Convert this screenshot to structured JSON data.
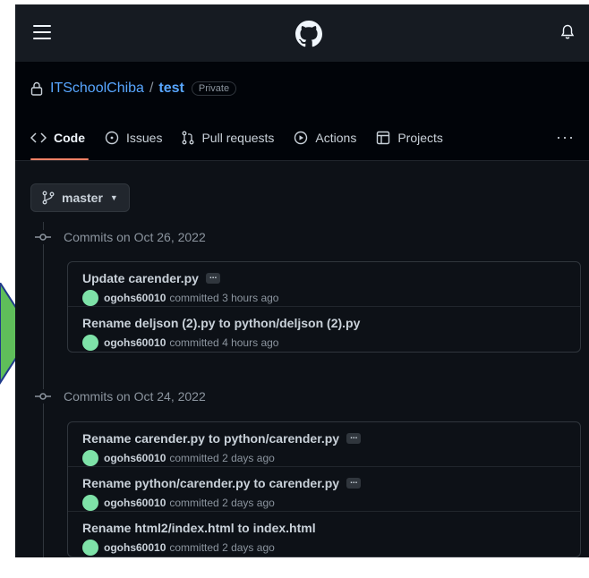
{
  "repo": {
    "owner": "ITSchoolChiba",
    "separator": "/",
    "name": "test",
    "visibility": "Private"
  },
  "tabs": [
    {
      "label": "Code",
      "icon": "code-icon",
      "active": true
    },
    {
      "label": "Issues",
      "icon": "issue-icon"
    },
    {
      "label": "Pull requests",
      "icon": "pull-request-icon"
    },
    {
      "label": "Actions",
      "icon": "play-icon"
    },
    {
      "label": "Projects",
      "icon": "table-icon"
    }
  ],
  "more_label": "···",
  "branch": {
    "name": "master"
  },
  "commit_groups": [
    {
      "heading": "Commits on Oct 26, 2022",
      "commits": [
        {
          "message": "Update carender.py",
          "has_ellipsis": true,
          "author": "ogohs60010",
          "action": "committed",
          "time": "3 hours ago"
        },
        {
          "message": "Rename deljson (2).py to python/deljson (2).py",
          "has_ellipsis": false,
          "author": "ogohs60010",
          "action": "committed",
          "time": "4 hours ago"
        }
      ]
    },
    {
      "heading": "Commits on Oct 24, 2022",
      "commits": [
        {
          "message": "Rename carender.py to python/carender.py",
          "has_ellipsis": true,
          "author": "ogohs60010",
          "action": "committed",
          "time": "2 days ago"
        },
        {
          "message": "Rename python/carender.py to carender.py",
          "has_ellipsis": true,
          "author": "ogohs60010",
          "action": "committed",
          "time": "2 days ago"
        },
        {
          "message": "Rename html2/index.html to index.html",
          "has_ellipsis": false,
          "author": "ogohs60010",
          "action": "committed",
          "time": "2 days ago"
        }
      ]
    }
  ],
  "ellipsis_label": "...",
  "colors": {
    "bg": "#0d1117",
    "header": "#161b22",
    "link": "#58a6ff",
    "active_tab": "#f78166",
    "arrow": "#5cb85c"
  }
}
